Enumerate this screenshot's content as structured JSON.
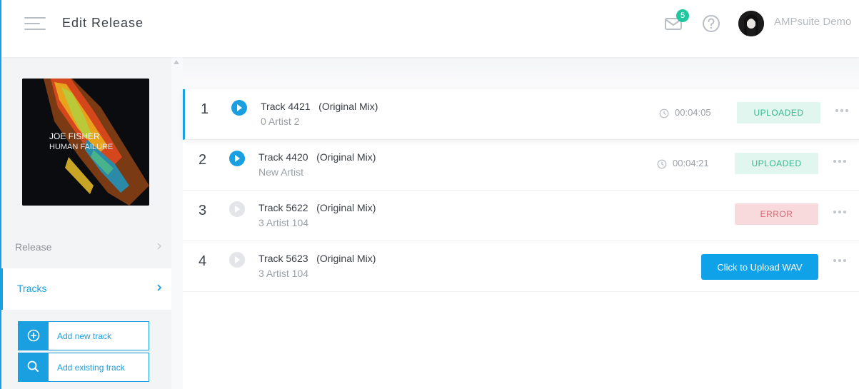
{
  "header": {
    "title": "Edit Release",
    "notification_count": "5",
    "user_name": "AMPsuite Demo"
  },
  "sidebar": {
    "cover_artist": "JOE FISHER",
    "cover_title": "HUMAN FAILURE",
    "items": [
      {
        "label": "Release"
      },
      {
        "label": "Tracks"
      }
    ],
    "buttons": {
      "add_new": "Add new track",
      "add_existing": "Add existing track"
    }
  },
  "tracks": [
    {
      "number": "1",
      "title": "Track 4421   (Original Mix)",
      "artist": "0 Artist 2",
      "duration": "00:04:05",
      "status": "UPLOADED"
    },
    {
      "number": "2",
      "title": "Track 4420   (Original Mix)",
      "artist": "New Artist",
      "duration": "00:04:21",
      "status": "UPLOADED"
    },
    {
      "number": "3",
      "title": "Track 5622   (Original Mix)",
      "artist": "3 Artist 104",
      "duration": "",
      "status": "ERROR"
    },
    {
      "number": "4",
      "title": "Track 5623   (Original Mix)",
      "artist": "3 Artist 104",
      "duration": "",
      "upload_label": "Click to Upload WAV"
    }
  ],
  "colors": {
    "accent": "#1a9fe0",
    "uploaded_bg": "#e0f6ef",
    "uploaded_text": "#37b88f",
    "error_bg": "#f8d9dc",
    "error_text": "#d06c76",
    "badge": "#22c7a0"
  },
  "icons": [
    "menu-icon",
    "mail-icon",
    "help-icon",
    "avatar",
    "chevron-right-icon",
    "plus-circle-icon",
    "search-icon",
    "play-icon",
    "clock-icon",
    "more-icon"
  ]
}
